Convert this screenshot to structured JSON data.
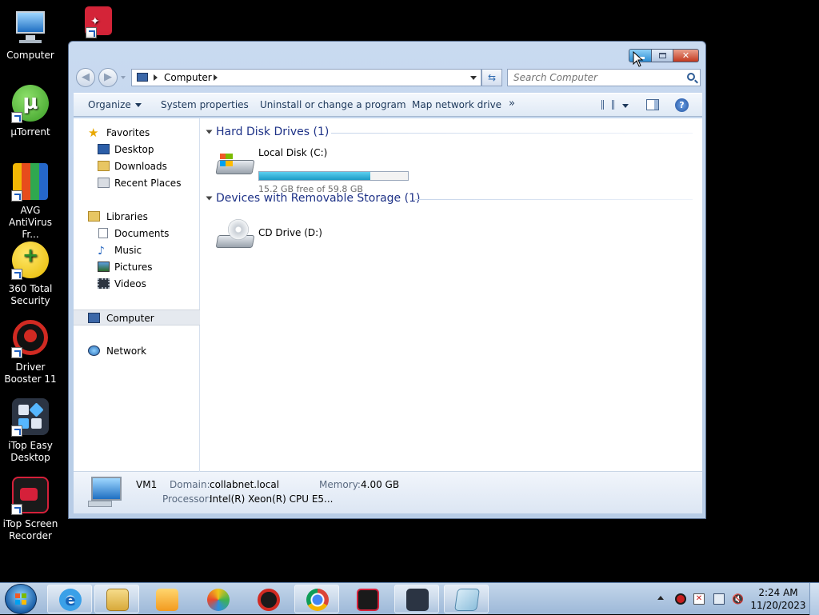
{
  "desktop": {
    "icons": [
      {
        "label_line1": "Computer",
        "label_line2": ""
      },
      {
        "label_line1": "µTorrent",
        "label_line2": ""
      },
      {
        "label_line1": "AVG",
        "label_line2": "AntiVirus Fr..."
      },
      {
        "label_line1": "360 Total",
        "label_line2": "Security"
      },
      {
        "label_line1": "Driver",
        "label_line2": "Booster 11"
      },
      {
        "label_line1": "iTop Easy",
        "label_line2": "Desktop"
      },
      {
        "label_line1": "iTop Screen",
        "label_line2": "Recorder"
      }
    ]
  },
  "window": {
    "close_glyph": "✕",
    "address": {
      "crumb": "Computer"
    },
    "search": {
      "placeholder": "Search Computer"
    },
    "toolbar": {
      "organize": "Organize",
      "system_properties": "System properties",
      "uninstall": "Uninstall or change a program",
      "map_network_drive": "Map network drive",
      "more": "»",
      "help": "?"
    },
    "nav": {
      "favorites": "Favorites",
      "desktop": "Desktop",
      "downloads": "Downloads",
      "recent_places": "Recent Places",
      "libraries": "Libraries",
      "documents": "Documents",
      "music": "Music",
      "pictures": "Pictures",
      "videos": "Videos",
      "computer": "Computer",
      "network": "Network"
    },
    "content": {
      "group_hdd": "Hard Disk Drives (1)",
      "local_disk": "Local Disk (C:)",
      "local_disk_free": "15.2 GB free of 59.8 GB",
      "local_disk_used_fraction": 0.746,
      "group_removable": "Devices with Removable Storage (1)",
      "cd_drive": "CD Drive (D:)"
    },
    "details": {
      "name": "VM1",
      "domain_label": "Domain:",
      "domain_value": "collabnet.local",
      "memory_label": "Memory:",
      "memory_value": "4.00 GB",
      "processor_label": "Processor:",
      "processor_value": "Intel(R) Xeon(R) CPU E5..."
    }
  },
  "taskbar": {
    "clock_time": "2:24 AM",
    "clock_date": "11/20/2023"
  },
  "colors": {
    "accent_blue": "#1e3287",
    "drive_fill": "#1c9bc6"
  }
}
